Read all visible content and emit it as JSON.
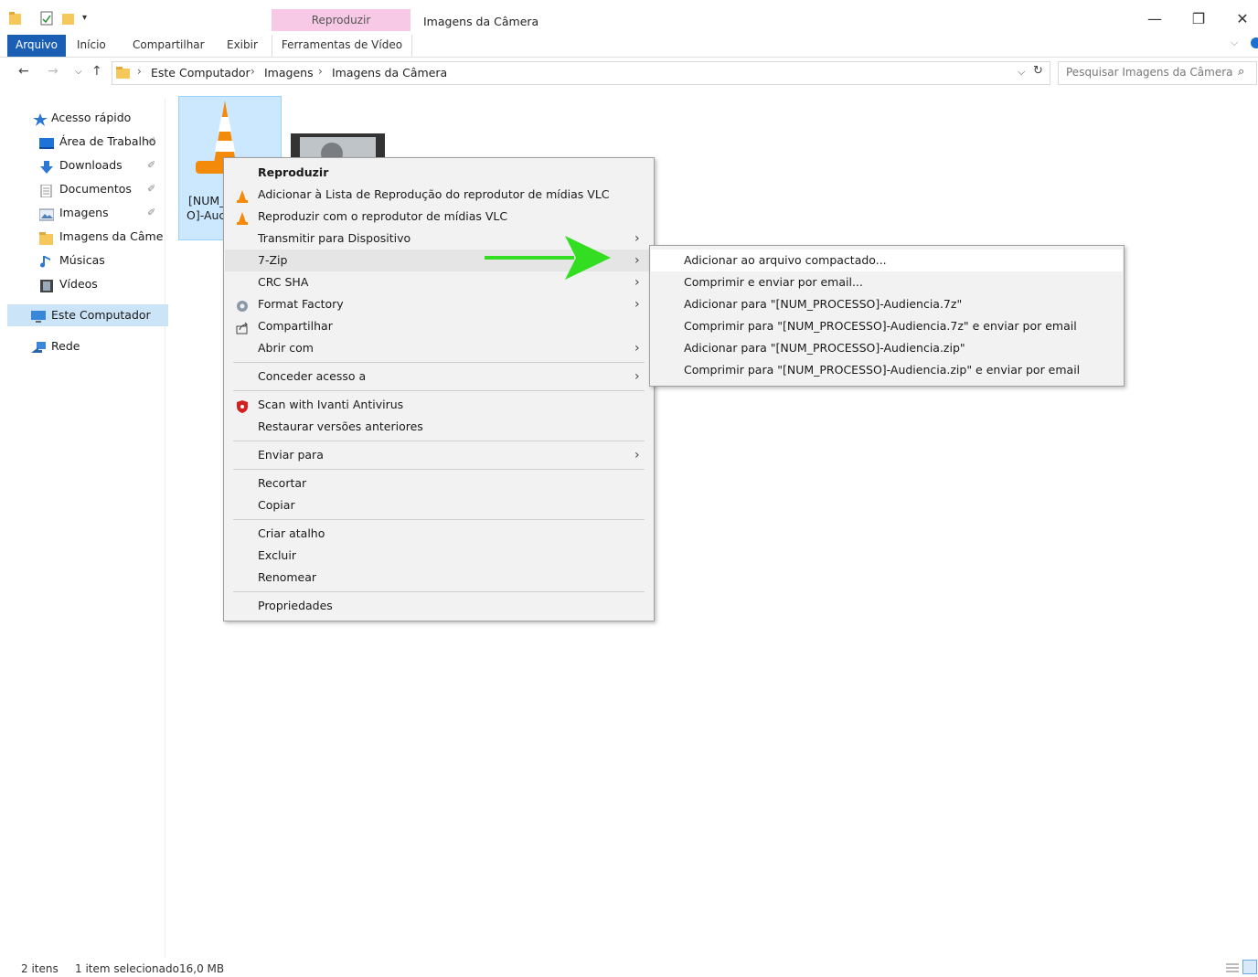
{
  "window": {
    "title": "Imagens da Câmera",
    "context_tab_header": "Reproduzir",
    "buttons": {
      "minimize": "—",
      "restore": "❐",
      "close": "✕"
    }
  },
  "ribbon": {
    "tabs": [
      "Arquivo",
      "Início",
      "Compartilhar",
      "Exibir",
      "Ferramentas de Vídeo"
    ]
  },
  "address": {
    "breadcrumbs": [
      "Este Computador",
      "Imagens",
      "Imagens da Câmera"
    ],
    "search_placeholder": "Pesquisar Imagens da Câmera"
  },
  "sidebar": {
    "items": [
      {
        "label": "Acesso rápido",
        "icon": "star-icon"
      },
      {
        "label": "Área de Trabalho",
        "icon": "desktop-icon",
        "pinned": true
      },
      {
        "label": "Downloads",
        "icon": "download-icon",
        "pinned": true
      },
      {
        "label": "Documentos",
        "icon": "document-icon",
        "pinned": true
      },
      {
        "label": "Imagens",
        "icon": "pictures-icon",
        "pinned": true
      },
      {
        "label": "Imagens da Câmera",
        "icon": "folder-icon"
      },
      {
        "label": "Músicas",
        "icon": "music-icon"
      },
      {
        "label": "Vídeos",
        "icon": "video-icon"
      },
      {
        "label": "Este Computador",
        "icon": "computer-icon"
      },
      {
        "label": "Rede",
        "icon": "network-icon"
      }
    ]
  },
  "files": [
    {
      "name_line1": "[NUM_",
      "name_line2": "O]-Auc",
      "icon": "vlc-icon",
      "selected": true
    },
    {
      "name_line1": "",
      "name_line2": "",
      "icon": "video-thumbnail-icon",
      "selected": false
    }
  ],
  "context_menu": {
    "items": [
      {
        "label": "Reproduzir",
        "bold": true
      },
      {
        "label": "Adicionar à Lista de Reprodução do reprodutor de mídias VLC",
        "icon": "vlc-icon"
      },
      {
        "label": "Reproduzir com o reprodutor de mídias VLC",
        "icon": "vlc-icon"
      },
      {
        "label": "Transmitir para Dispositivo",
        "submenu": true
      },
      {
        "label": "7-Zip",
        "submenu": true,
        "highlighted": true
      },
      {
        "label": "CRC SHA",
        "submenu": true
      },
      {
        "label": "Format Factory",
        "icon": "format-factory-icon",
        "submenu": true
      },
      {
        "label": "Compartilhar",
        "icon": "share-icon"
      },
      {
        "label": "Abrir com",
        "submenu": true
      },
      {
        "label": "Conceder acesso a",
        "submenu": true
      },
      {
        "label": "Scan with Ivanti Antivirus",
        "icon": "shield-icon"
      },
      {
        "label": "Restaurar versões anteriores"
      },
      {
        "label": "Enviar para",
        "submenu": true
      },
      {
        "label": "Recortar"
      },
      {
        "label": "Copiar"
      },
      {
        "label": "Criar atalho"
      },
      {
        "label": "Excluir"
      },
      {
        "label": "Renomear"
      },
      {
        "label": "Propriedades"
      }
    ]
  },
  "submenu_7zip": {
    "items": [
      "Adicionar ao arquivo compactado...",
      "Comprimir e enviar por email...",
      "Adicionar para \"[NUM_PROCESSO]-Audiencia.7z\"",
      "Comprimir para \"[NUM_PROCESSO]-Audiencia.7z\" e enviar por email",
      "Adicionar para \"[NUM_PROCESSO]-Audiencia.zip\"",
      "Comprimir para \"[NUM_PROCESSO]-Audiencia.zip\" e enviar por email"
    ]
  },
  "status": {
    "items_count": "2 itens",
    "selection": "1 item selecionado",
    "size": "16,0 MB"
  },
  "colors": {
    "accent": "#1a5fb4",
    "arrow": "#33dd22",
    "context_tab": "#f7c9e6"
  }
}
